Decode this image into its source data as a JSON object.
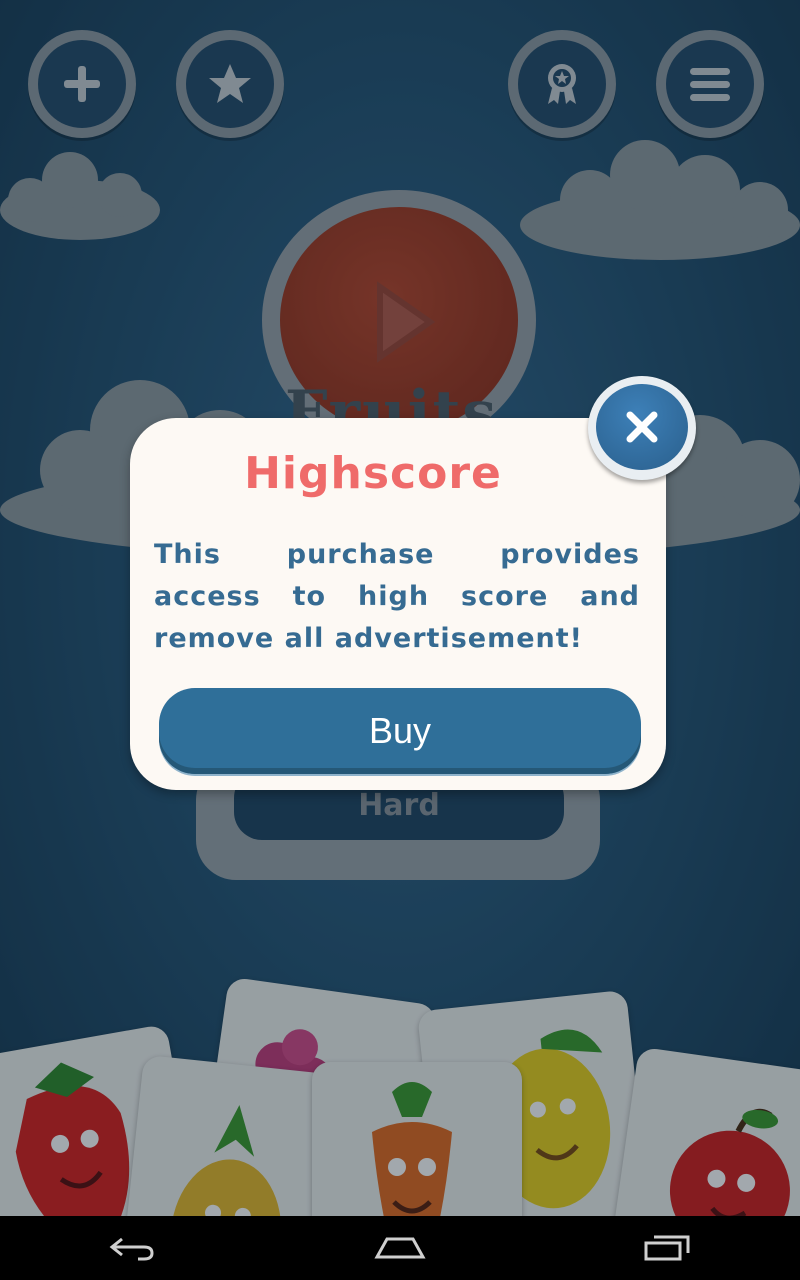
{
  "top_bar": {
    "left_buttons": [
      {
        "icon": "plus-icon"
      },
      {
        "icon": "star-icon"
      }
    ],
    "right_buttons": [
      {
        "icon": "award-icon"
      },
      {
        "icon": "menu-icon"
      }
    ]
  },
  "background": {
    "logo_partial": "Fruits",
    "difficulty_label": "Hard"
  },
  "modal": {
    "title": "Highscore",
    "message": "This purchase provides access to high score and remove all advertisement!",
    "buy_label": "Buy",
    "close_icon": "close-icon"
  },
  "colors": {
    "title": "#ef6b6a",
    "message": "#366b92",
    "buy_button": "#2f6f99",
    "modal_bg": "#fdf9f4"
  },
  "navbar": {
    "buttons": [
      {
        "icon": "back-icon"
      },
      {
        "icon": "home-icon"
      },
      {
        "icon": "recent-apps-icon"
      }
    ]
  }
}
